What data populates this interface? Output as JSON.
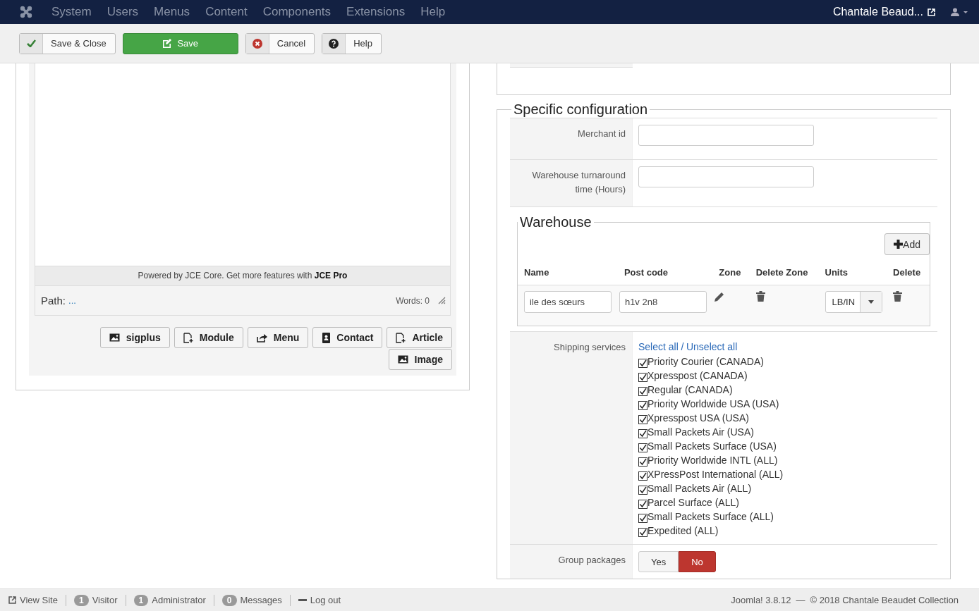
{
  "navbar": {
    "menu": [
      "System",
      "Users",
      "Menus",
      "Content",
      "Components",
      "Extensions",
      "Help"
    ],
    "user": "Chantale Beaud..."
  },
  "toolbar": {
    "buttons": [
      {
        "label": "Save & Close",
        "kind": "save-close"
      },
      {
        "label": "Save",
        "kind": "save"
      },
      {
        "label": "Cancel",
        "kind": "cancel"
      },
      {
        "label": "Help",
        "kind": "help"
      }
    ]
  },
  "editor": {
    "footer_text": "Powered by JCE Core. Get more features with **JCE Pro**",
    "path_label": "Path:",
    "path_value": "...",
    "word_count": "Words: 0",
    "buttons": [
      {
        "label": "sigplus",
        "kind": "image"
      },
      {
        "label": "Module",
        "kind": "document"
      },
      {
        "label": "Menu",
        "kind": "share"
      },
      {
        "label": "Contact",
        "kind": "contact"
      },
      {
        "label": "Article",
        "kind": "document"
      },
      {
        "label": "Image",
        "kind": "picture"
      }
    ]
  },
  "config": {
    "title": "Specific configuration",
    "fields": [
      {
        "label": "Merchant id"
      },
      {
        "label": "Warehouse turnaround time (Hours)"
      }
    ]
  },
  "warehouse": {
    "title": "Warehouse",
    "add_button": "Add",
    "columns": [
      "Name",
      "Post code",
      "Zone",
      "Delete Zone",
      "Units",
      "Delete"
    ],
    "rows": [
      {
        "name": "ile des sœurs",
        "post_code": "h1v 2n8",
        "units": "LB/IN"
      }
    ]
  },
  "shipping": {
    "label": "Shipping services",
    "select_all": "Select all",
    "separator": "/",
    "unselect_all": "Unselect all",
    "services": [
      {
        "label": "Priority Courier (CANADA)",
        "checked": true
      },
      {
        "label": "Xpresspost (CANADA)",
        "checked": true
      },
      {
        "label": "Regular (CANADA)",
        "checked": true
      },
      {
        "label": "Priority Worldwide USA (USA)",
        "checked": true
      },
      {
        "label": "Xpresspost USA (USA)",
        "checked": true
      },
      {
        "label": "Small Packets Air (USA)",
        "checked": true
      },
      {
        "label": "Small Packets Surface (USA)",
        "checked": true
      },
      {
        "label": "Priority Worldwide INTL (ALL)",
        "checked": true
      },
      {
        "label": "XPressPost International (ALL)",
        "checked": true
      },
      {
        "label": "Small Packets Air (ALL)",
        "checked": true
      },
      {
        "label": "Parcel Surface (ALL)",
        "checked": true
      },
      {
        "label": "Small Packets Surface (ALL)",
        "checked": true
      },
      {
        "label": "Expedited (ALL)",
        "checked": true
      }
    ]
  },
  "group_packages": {
    "label": "Group packages",
    "options": [
      {
        "label": "Yes",
        "selected": false
      },
      {
        "label": "No",
        "selected": true
      }
    ]
  },
  "status_bar": {
    "items": [
      {
        "kind": "link",
        "label": "View Site"
      },
      {
        "kind": "count",
        "count": "1",
        "label": "Visitor"
      },
      {
        "kind": "count",
        "count": "1",
        "label": "Administrator"
      },
      {
        "kind": "count",
        "count": "0",
        "label": "Messages"
      },
      {
        "kind": "logout",
        "label": "Log out"
      }
    ],
    "version": "Joomla! 3.8.12",
    "separator": "—",
    "copyright": "© 2018 Chantale Beaudet Collection"
  }
}
